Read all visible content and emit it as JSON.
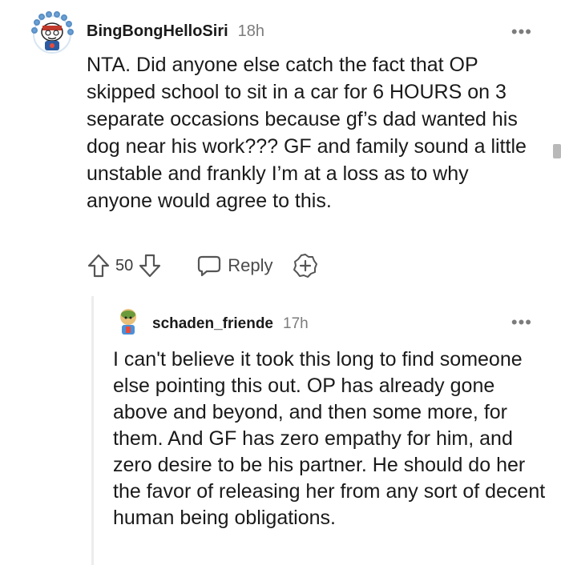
{
  "comment": {
    "username": "BingBongHelloSiri",
    "time": "18h",
    "more": "•••",
    "body": "NTA. Did anyone else catch the fact that OP skipped school to sit in a car for 6 HOURS on 3 separate occasions because gf’s dad wanted his dog near his work??? GF and family sound a little unstable and frankly I’m at a loss as to why anyone would agree to this.",
    "votes": "50",
    "reply_label": "Reply"
  },
  "reply": {
    "username": "schaden_friende",
    "time": "17h",
    "more": "•••",
    "body": "I can't believe it took this long to find someone else pointing this out. OP has already gone above and beyond, and then some more, for them. And GF has zero empathy for him, and zero desire to be his partner. He should do her the favor of releasing her from any sort of decent human being obligations."
  },
  "icons": {
    "upvote": "upvote-icon",
    "downvote": "downvote-icon",
    "reply": "reply-bubble-icon",
    "award": "award-plus-icon",
    "more": "more-options-icon"
  },
  "colors": {
    "text": "#1a1a1b",
    "meta": "#7c7c7c",
    "thread": "#ececec"
  }
}
